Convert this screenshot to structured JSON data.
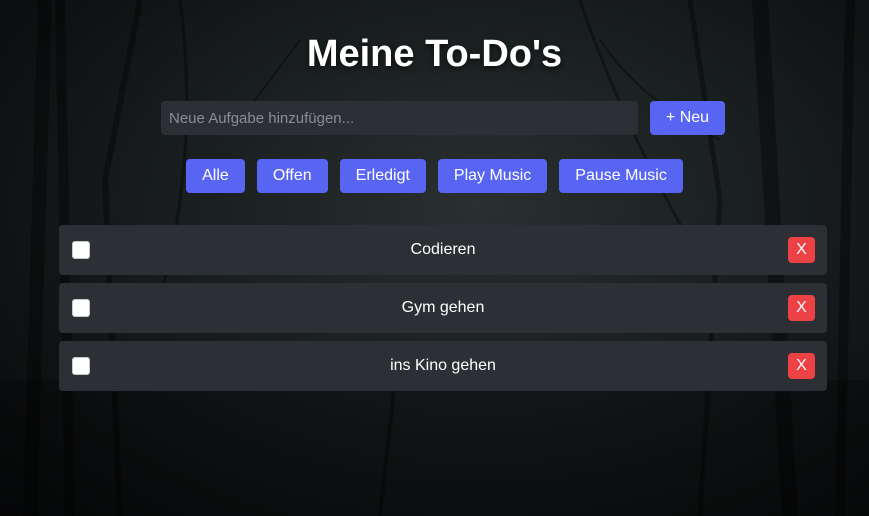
{
  "title": "Meine To-Do's",
  "input": {
    "placeholder": "Neue Aufgabe hinzufügen...",
    "value": ""
  },
  "add_button": "+ Neu",
  "filters": [
    "Alle",
    "Offen",
    "Erledigt",
    "Play Music",
    "Pause Music"
  ],
  "todos": [
    {
      "text": "Codieren",
      "done": false,
      "delete_label": "X"
    },
    {
      "text": "Gym gehen",
      "done": false,
      "delete_label": "X"
    },
    {
      "text": "ins Kino gehen",
      "done": false,
      "delete_label": "X"
    }
  ],
  "colors": {
    "accent": "#5865f2",
    "danger": "#ed4245",
    "card": "#2c2f33"
  }
}
